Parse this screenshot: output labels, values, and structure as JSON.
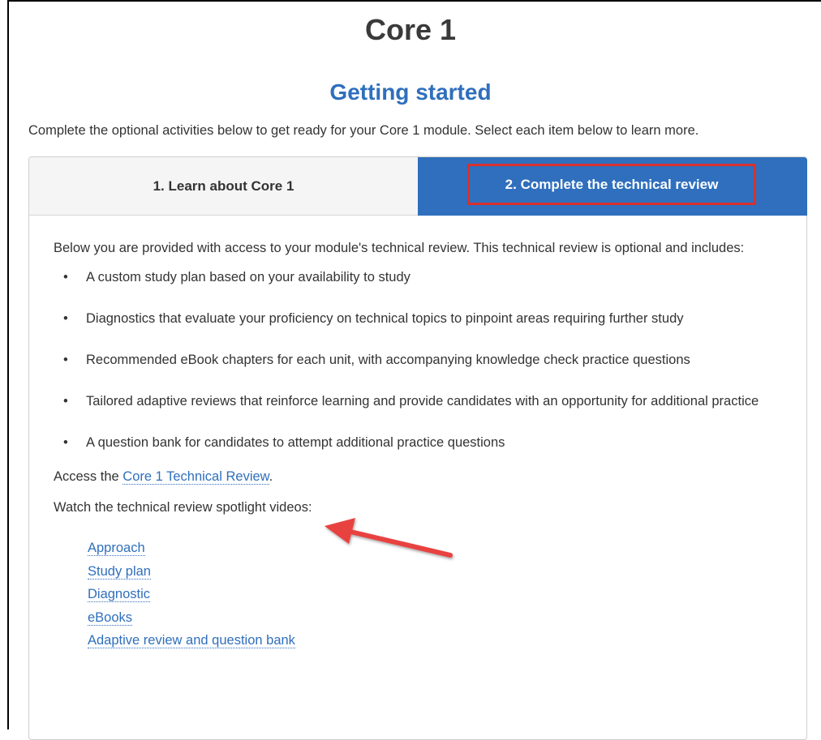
{
  "page": {
    "title": "Core 1",
    "section_title": "Getting started",
    "intro": "Complete the optional activities below to get ready for your Core 1 module. Select each item below to learn more."
  },
  "tabs": [
    {
      "label": "1. Learn about Core 1",
      "active": false
    },
    {
      "label": "2. Complete the technical review",
      "active": true
    }
  ],
  "content": {
    "description": "Below you are provided with access to your module's technical review. This technical review is optional and includes:",
    "features": [
      "A custom study plan based on your availability to study",
      "Diagnostics that evaluate your proficiency on technical topics to pinpoint areas requiring further study",
      "Recommended eBook chapters for each unit, with accompanying knowledge check practice questions",
      "Tailored adaptive reviews that reinforce learning and provide candidates with an opportunity for additional practice",
      "A question bank for candidates to attempt additional practice questions"
    ],
    "access_prefix": "Access the ",
    "access_link": "Core 1 Technical Review",
    "access_suffix": ".",
    "watch_text": "Watch the technical review spotlight videos:",
    "videos": [
      "Approach",
      "Study plan",
      "Diagnostic",
      "eBooks",
      "Adaptive review and question bank"
    ]
  },
  "colors": {
    "accent": "#2f6fbd",
    "highlight": "#d8302f",
    "arrow": "#e8423f"
  }
}
